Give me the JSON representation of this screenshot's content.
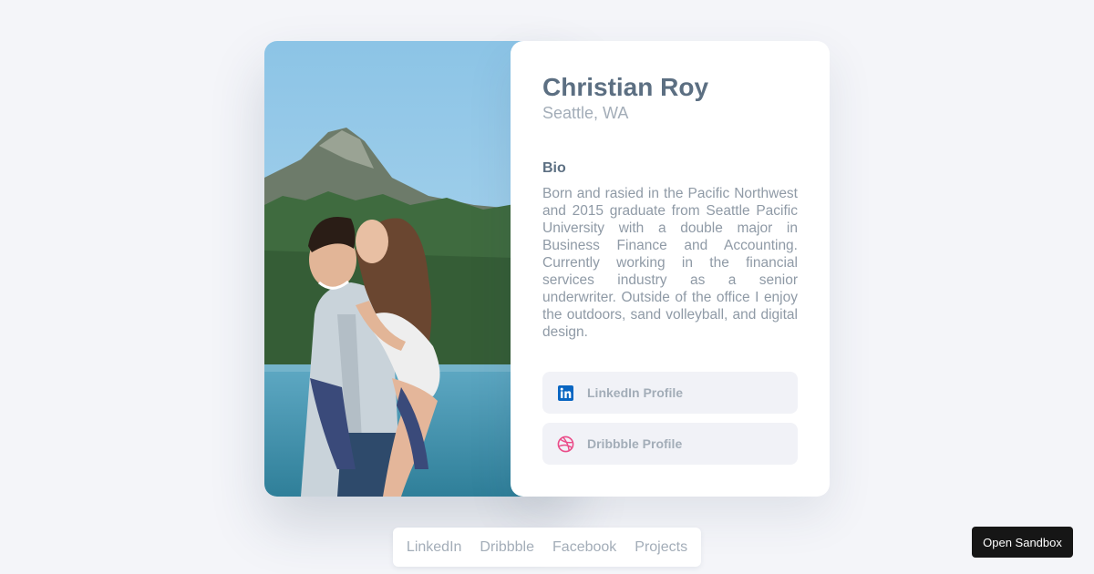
{
  "profile": {
    "name": "Christian Roy",
    "location": "Seattle, WA",
    "bio_heading": "Bio",
    "bio_text": "Born and rasied in the Pacific Northwest and 2015 graduate from Seattle Pacific University with a double major in Business Finance and Accounting. Currently working in the financial services industry as a senior underwriter. Outside of the office I enjoy the outdoors, sand volleyball, and digital design."
  },
  "buttons": {
    "linkedin": {
      "label": "LinkedIn Profile",
      "icon": "linkedin-icon",
      "color": "#0a66c2"
    },
    "dribbble": {
      "label": "Dribbble Profile",
      "icon": "dribbble-icon",
      "color": "#ea4c89"
    }
  },
  "footer_nav": {
    "items": [
      "LinkedIn",
      "Dribbble",
      "Facebook",
      "Projects"
    ]
  },
  "sandbox_button": {
    "label": "Open Sandbox"
  }
}
